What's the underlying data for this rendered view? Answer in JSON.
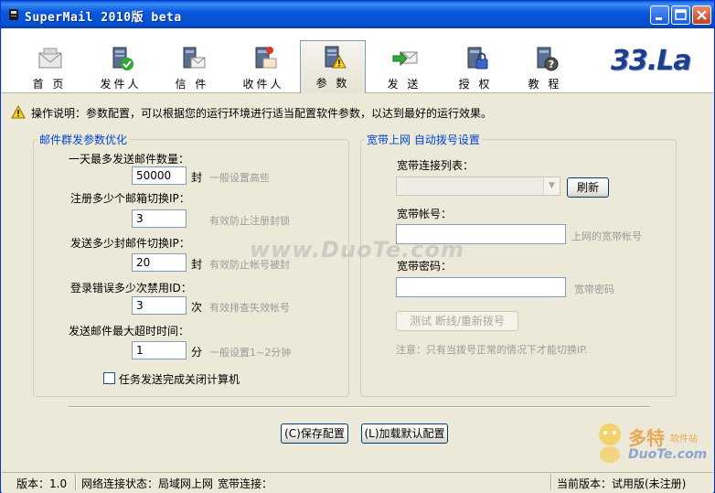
{
  "window": {
    "title": "SuperMail 2010版 beta"
  },
  "toolbar": {
    "items": [
      {
        "label": "首 页",
        "icon": "home-mail-icon"
      },
      {
        "label": "发件人",
        "icon": "sender-icon"
      },
      {
        "label": "信 件",
        "icon": "letter-icon"
      },
      {
        "label": "收件人",
        "icon": "recipient-icon"
      },
      {
        "label": "参 数",
        "icon": "settings-warning-icon",
        "active": true
      },
      {
        "label": "发 送",
        "icon": "send-icon"
      },
      {
        "label": "授 权",
        "icon": "authorize-icon"
      },
      {
        "label": "教 程",
        "icon": "help-icon"
      }
    ],
    "logo": "33.La"
  },
  "info": {
    "text": "操作说明：参数配置，可以根据您的运行环境进行适当配置软件参数，以达到最好的运行效果。"
  },
  "mail_group": {
    "legend": "邮件群发参数优化",
    "daily_max_label": "一天最多发送邮件数量：",
    "daily_max_value": "50000",
    "daily_max_unit": "封",
    "daily_max_hint": "一般设置高些",
    "switch_ip_mailbox_label": "注册多少个邮箱切换IP：",
    "switch_ip_mailbox_value": "3",
    "switch_ip_mailbox_hint": "有效防止注册封锁",
    "switch_ip_mail_label": "发送多少封邮件切换IP：",
    "switch_ip_mail_value": "20",
    "switch_ip_mail_unit": "封",
    "switch_ip_mail_hint": "有效防止帐号被封",
    "login_error_label": "登录错误多少次禁用ID：",
    "login_error_value": "3",
    "login_error_unit": "次",
    "login_error_hint": "有效排查失效帐号",
    "timeout_label": "发送邮件最大超时时间：",
    "timeout_value": "1",
    "timeout_unit": "分",
    "timeout_hint": "一般设置1~2分钟",
    "shutdown_label": "任务发送完成关闭计算机"
  },
  "broadband_group": {
    "legend": "宽带上网 自动拨号设置",
    "list_label": "宽带连接列表：",
    "refresh_button": "刷新",
    "account_label": "宽带帐号：",
    "account_hint": "上网的宽带帐号",
    "password_label": "宽带密码：",
    "password_hint": "宽带密码",
    "test_button": "测试 断线/重新拨号",
    "note": "注意：只有当拨号正常的情况下才能切换IP."
  },
  "watermark": "www.DuoTe.com",
  "buttons": {
    "save": "(C)保存配置",
    "load_default": "(L)加载默认配置"
  },
  "statusbar": {
    "version": "版本：1.0",
    "net_status": "网络连接状态：局域网上网",
    "broadband": "宽带连接：",
    "current_version": "当前版本：试用版(未注册)"
  },
  "corner_logo": {
    "brand": "多特",
    "sub": "软件站",
    "domain": "DuoTe.com"
  }
}
